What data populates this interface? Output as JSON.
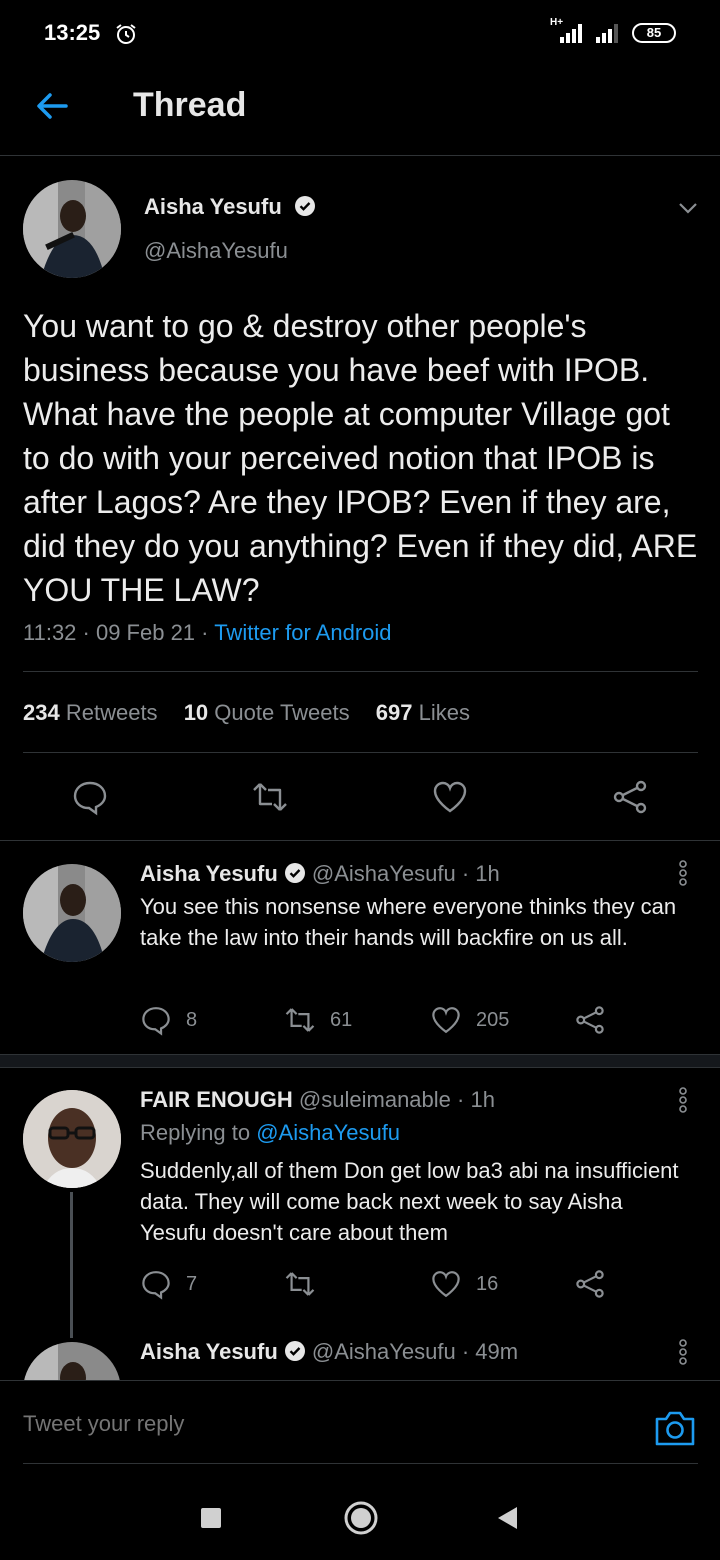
{
  "status_bar": {
    "time": "13:25",
    "network": "H+",
    "battery": "85"
  },
  "header": {
    "title": "Thread"
  },
  "main_tweet": {
    "author_name": "Aisha Yesufu",
    "author_handle": "@AishaYesufu",
    "text": "You want to go & destroy other people's business because you have beef with IPOB. What have the people at computer Village got to do with your perceived notion that IPOB is after Lagos? Are they IPOB? Even if they are, did they do you anything? Even if they did, ARE YOU THE LAW?",
    "timestamp": "11:32 · 09 Feb 21 · ",
    "source": "Twitter for Android",
    "retweets_count": "234",
    "retweets_label": "Retweets",
    "quotes_count": "10",
    "quotes_label": "Quote Tweets",
    "likes_count": "697",
    "likes_label": "Likes"
  },
  "replies": [
    {
      "name": "Aisha Yesufu",
      "handle": "@AishaYesufu",
      "time": "· 1h",
      "text": "You see this nonsense where everyone thinks they can take the law into their hands will backfire on us all.",
      "reply_count": "8",
      "retweet_count": "61",
      "like_count": "205"
    },
    {
      "name": "FAIR ENOUGH",
      "handle": "@suleimanable",
      "time": "· 1h",
      "replying_prefix": "Replying to",
      "replying_to": "@AishaYesufu",
      "text": "Suddenly,all of them Don get low ba3 abi na insufficient data. They will come back next week to say Aisha Yesufu doesn't care about them",
      "reply_count": "7",
      "retweet_count": "",
      "like_count": "16"
    },
    {
      "name": "Aisha Yesufu",
      "handle": "@AishaYesufu",
      "time": "· 49m"
    }
  ],
  "composer": {
    "placeholder": "Tweet your reply"
  },
  "colors": {
    "accent": "#1d9bf0",
    "background": "#000000",
    "muted": "#8b8f93"
  }
}
